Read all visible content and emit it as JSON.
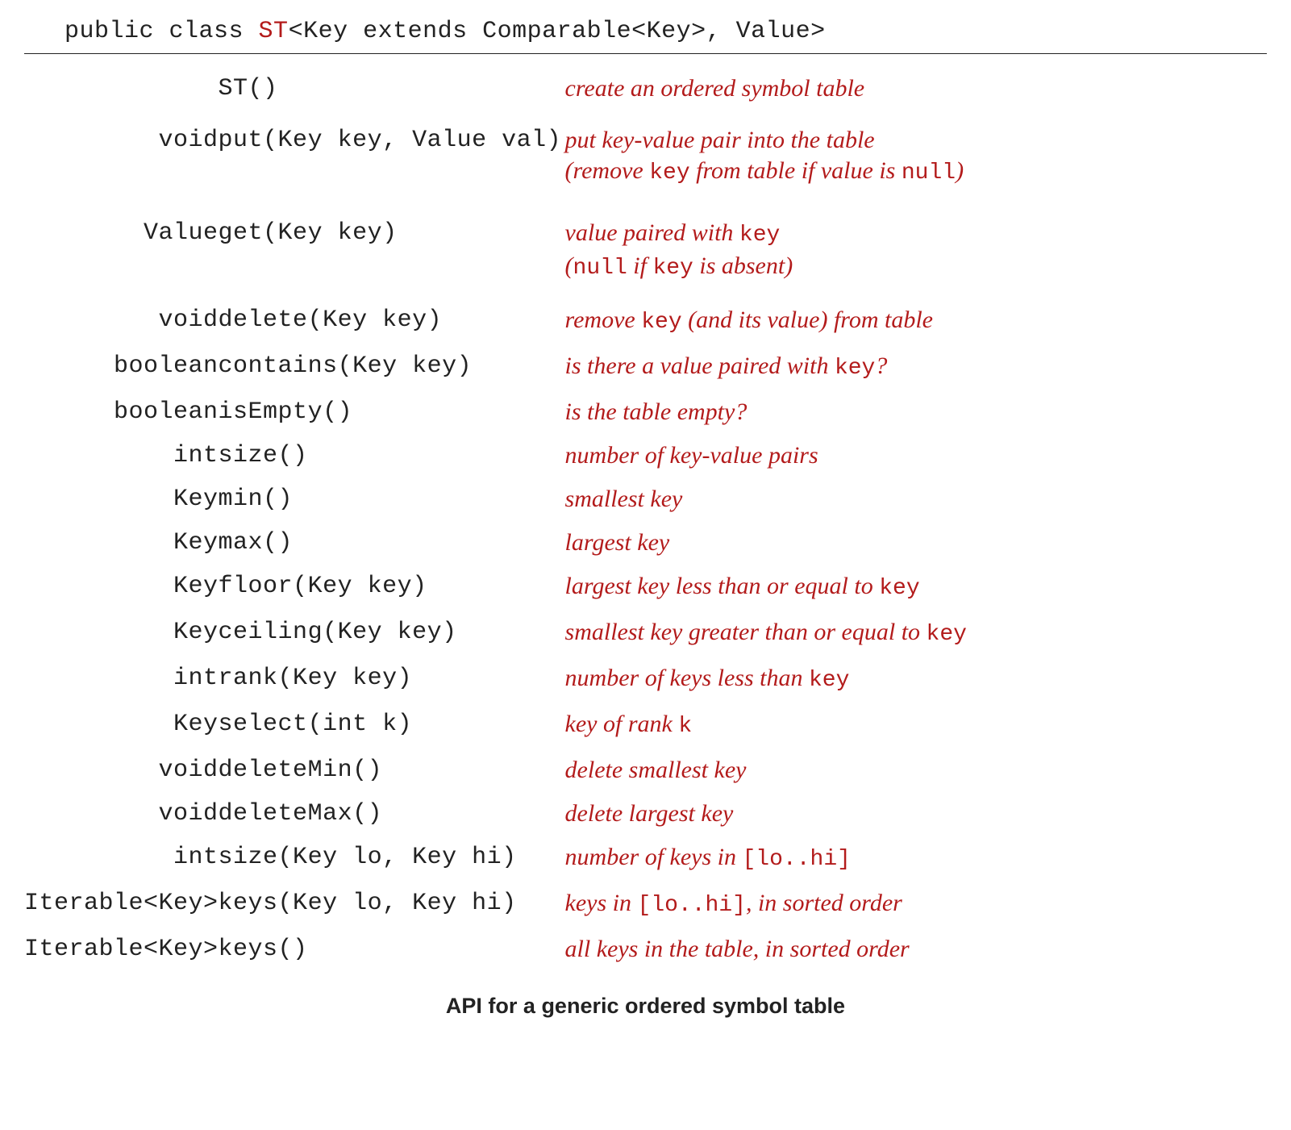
{
  "header": {
    "prefix": "public class ",
    "classname": "ST",
    "generics": "<Key extends Comparable<Key>, Value>"
  },
  "rows": [
    {
      "rt": "",
      "sig": "ST()",
      "desc": [
        {
          "t": "create an ordered symbol table"
        }
      ],
      "tall": false
    },
    {
      "rt": "void",
      "sig": "put(Key key, Value val)",
      "desc": [
        {
          "t": "put key-value pair into the table"
        },
        {
          "br": true
        },
        {
          "t": "(remove "
        },
        {
          "c": "key"
        },
        {
          "t": " from table if value is "
        },
        {
          "c": "null"
        },
        {
          "t": ")"
        }
      ],
      "tall": true
    },
    {
      "rt": "Value",
      "sig": "get(Key key)",
      "desc": [
        {
          "t": "value paired with "
        },
        {
          "c": "key"
        },
        {
          "br": true
        },
        {
          "t": "("
        },
        {
          "c": "null"
        },
        {
          "t": " if "
        },
        {
          "c": "key"
        },
        {
          "t": " is absent)"
        }
      ],
      "tall": true
    },
    {
      "rt": "void",
      "sig": "delete(Key key)",
      "desc": [
        {
          "t": "remove "
        },
        {
          "c": "key"
        },
        {
          "t": " (and its value) from table"
        }
      ],
      "tall": false
    },
    {
      "rt": "boolean",
      "sig": "contains(Key key)",
      "desc": [
        {
          "t": "is there a value paired with "
        },
        {
          "c": "key"
        },
        {
          "t": "?"
        }
      ],
      "tall": false
    },
    {
      "rt": "boolean",
      "sig": "isEmpty()",
      "desc": [
        {
          "t": "is the table empty?"
        }
      ],
      "tall": false
    },
    {
      "rt": "int",
      "sig": "size()",
      "desc": [
        {
          "t": "number of key-value pairs"
        }
      ],
      "tall": false
    },
    {
      "rt": "Key",
      "sig": "min()",
      "desc": [
        {
          "t": "smallest key"
        }
      ],
      "tall": false
    },
    {
      "rt": "Key",
      "sig": "max()",
      "desc": [
        {
          "t": "largest key"
        }
      ],
      "tall": false
    },
    {
      "rt": "Key",
      "sig": "floor(Key key)",
      "desc": [
        {
          "t": "largest key less than or equal to "
        },
        {
          "c": "key"
        }
      ],
      "tall": false
    },
    {
      "rt": "Key",
      "sig": "ceiling(Key key)",
      "desc": [
        {
          "t": "smallest key greater than or equal to "
        },
        {
          "c": "key"
        }
      ],
      "tall": false
    },
    {
      "rt": "int",
      "sig": "rank(Key key)",
      "desc": [
        {
          "t": "number of keys less than "
        },
        {
          "c": "key"
        }
      ],
      "tall": false
    },
    {
      "rt": "Key",
      "sig": "select(int k)",
      "desc": [
        {
          "t": "key of rank "
        },
        {
          "c": "k"
        }
      ],
      "tall": false
    },
    {
      "rt": "void",
      "sig": "deleteMin()",
      "desc": [
        {
          "t": "delete smallest key"
        }
      ],
      "tall": false
    },
    {
      "rt": "void",
      "sig": "deleteMax()",
      "desc": [
        {
          "t": "delete largest key"
        }
      ],
      "tall": false
    },
    {
      "rt": "int",
      "sig": "size(Key lo, Key hi)",
      "desc": [
        {
          "t": "number of keys in "
        },
        {
          "c": "[lo..hi]"
        }
      ],
      "tall": false
    },
    {
      "rt": "Iterable<Key>",
      "sig": "keys(Key lo, Key hi)",
      "desc": [
        {
          "t": "keys in "
        },
        {
          "c": "[lo..hi]"
        },
        {
          "t": ", in sorted order"
        }
      ],
      "tall": false
    },
    {
      "rt": "Iterable<Key>",
      "sig": "keys()",
      "desc": [
        {
          "t": "all keys in the table, in sorted order"
        }
      ],
      "tall": false
    }
  ],
  "caption": "API for a generic ordered symbol table"
}
